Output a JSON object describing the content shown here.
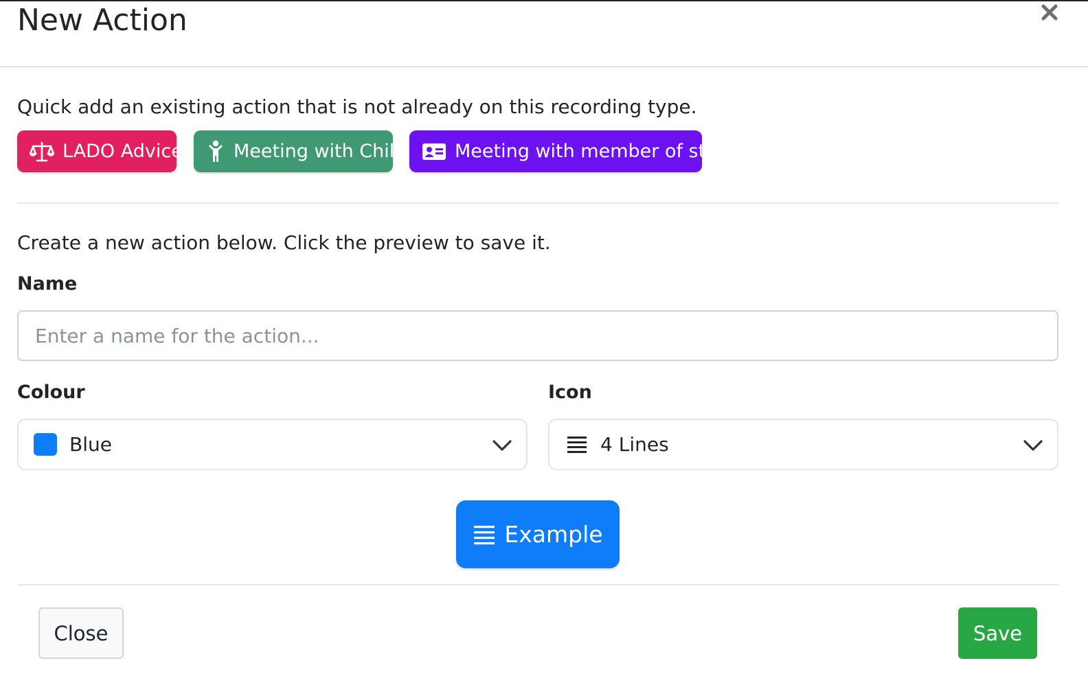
{
  "modal": {
    "title": "New Action"
  },
  "quick_add": {
    "text": "Quick add an existing action that is not already on this recording type.",
    "actions": [
      {
        "label": "LADO Advice",
        "icon": "balance-scale-icon",
        "color": "#e0205f"
      },
      {
        "label": "Meeting with Child",
        "icon": "child-icon",
        "color": "#3f9a73"
      },
      {
        "label": "Meeting with member of staff",
        "icon": "id-card-icon",
        "color": "#6c11ef"
      }
    ]
  },
  "create": {
    "text": "Create a new action below. Click the preview to save it."
  },
  "form": {
    "name_label": "Name",
    "name_placeholder": "Enter a name for the action...",
    "name_value": "",
    "colour_label": "Colour",
    "colour_value": "Blue",
    "colour_swatch": "#0f7cf9",
    "icon_label": "Icon",
    "icon_value": "4 Lines",
    "icon_name": "four-lines-icon"
  },
  "preview": {
    "label": "Example",
    "color": "#0f7cf9"
  },
  "footer": {
    "close_label": "Close",
    "save_label": "Save",
    "save_color": "#28a745"
  }
}
